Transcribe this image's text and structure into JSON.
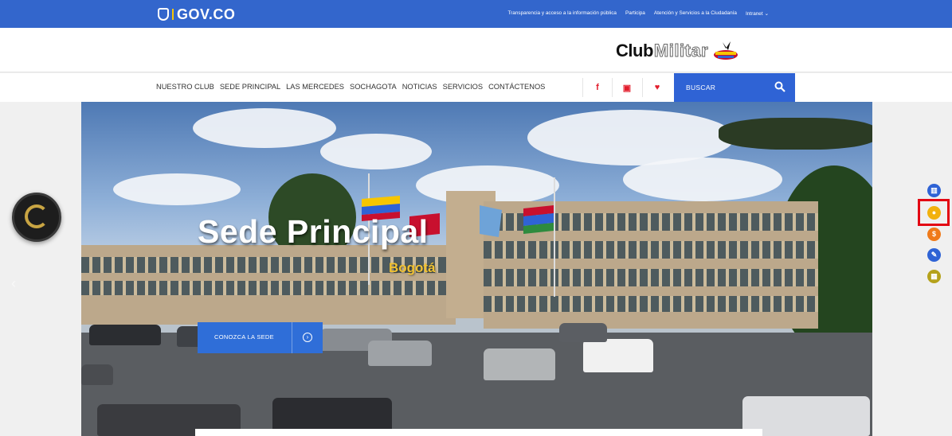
{
  "govbar": {
    "logo_text": "GOV.CO",
    "links": [
      "Transparencia y acceso a la información pública",
      "Participa",
      "Atención y Servicios a la Ciudadanía",
      "Intranet"
    ],
    "intranet_caret": "⌄"
  },
  "brand": {
    "club": "Club",
    "militar": "Militar"
  },
  "nav": {
    "items": [
      "NUESTRO CLUB",
      "SEDE PRINCIPAL",
      "LAS MERCEDES",
      "SOCHAGOTA",
      "NOTICIAS",
      "SERVICIOS",
      "CONTÁCTENOS"
    ],
    "social": {
      "facebook": "f",
      "instagram": "▣",
      "twitter": "♥"
    },
    "search_label": "BUSCAR"
  },
  "hero": {
    "title": "Sede Principal",
    "subtitle": "Bogotá",
    "cta_label": "CONOZCA LA SEDE",
    "prev_glyph": "‹"
  },
  "quick_links": [
    {
      "icon": "stats-icon",
      "color": "#2f63d5",
      "glyph": "▥"
    },
    {
      "icon": "user-icon",
      "color": "#f2b10d",
      "glyph": "●"
    },
    {
      "icon": "dollar-icon",
      "color": "#ef7a1a",
      "glyph": "$"
    },
    {
      "icon": "pencil-icon",
      "color": "#2f63d5",
      "glyph": "✎"
    },
    {
      "icon": "calendar-icon",
      "color": "#b5a21b",
      "glyph": "▦"
    }
  ],
  "colors": {
    "gov_blue": "#3366cc",
    "search_blue": "#2f63d5",
    "social_red": "#e21d2c",
    "highlight_red": "#e30613",
    "subtitle_gold": "#f1c232"
  }
}
